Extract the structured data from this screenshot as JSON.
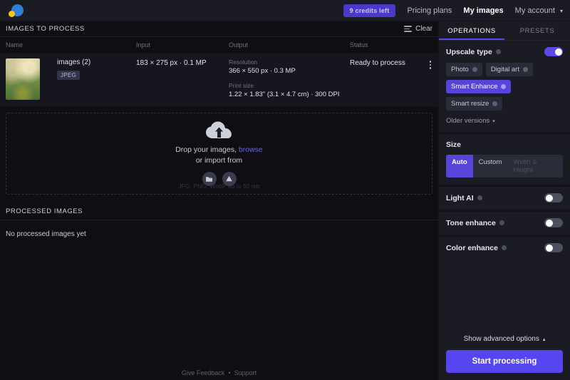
{
  "topbar": {
    "logo_name": "app-logo",
    "credits_badge": "9 credits left",
    "links": [
      {
        "label": "Pricing plans",
        "active": false
      },
      {
        "label": "My images",
        "active": true
      },
      {
        "label": "My account",
        "active": false
      }
    ]
  },
  "images_section": {
    "title": "IMAGES TO PROCESS",
    "clear_label": "Clear",
    "columns": {
      "name": "Name",
      "input": "Input",
      "output": "Output",
      "status": "Status"
    },
    "rows": [
      {
        "file_name": "images (2)",
        "format_tag": "JPEG",
        "input": "183 × 275 px · 0.1 MP",
        "output_resolution_label": "Resolution",
        "output_resolution_value": "366 × 550 px · 0.3 MP",
        "output_printsize_label": "Print size",
        "output_printsize_value": "1.22 × 1.83\" (3.1 × 4.7 cm) · 300 DPI",
        "status": "Ready to process"
      }
    ]
  },
  "dropzone": {
    "line1_prefix": "Drop your images, ",
    "browse": "browse",
    "line2": "or import from",
    "note": "JPG, PNG, WebP up to 50 mb",
    "import_sources": [
      "dropbox",
      "google-drive"
    ]
  },
  "processed_section": {
    "title": "PROCESSED IMAGES",
    "empty_text": "No processed images yet"
  },
  "footer": {
    "feedback": "Give Feedback",
    "separator": "•",
    "support": "Support"
  },
  "panel": {
    "tabs": [
      {
        "label": "OPERATIONS",
        "active": true
      },
      {
        "label": "PRESETS",
        "active": false
      }
    ],
    "upscale": {
      "title": "Upscale type",
      "enabled": true,
      "chips": [
        {
          "label": "Photo",
          "selected": false
        },
        {
          "label": "Digital art",
          "selected": false
        },
        {
          "label": "Smart Enhance",
          "selected": true
        },
        {
          "label": "Smart resize",
          "selected": false
        }
      ],
      "older_versions": "Older versions"
    },
    "size": {
      "title": "Size",
      "options": [
        {
          "label": "Auto",
          "selected": true,
          "disabled": false
        },
        {
          "label": "Custom",
          "selected": false,
          "disabled": false
        },
        {
          "label": "Width & Height",
          "selected": false,
          "disabled": true
        }
      ]
    },
    "toggles": [
      {
        "label": "Light AI",
        "enabled": false
      },
      {
        "label": "Tone enhance",
        "enabled": false
      },
      {
        "label": "Color enhance",
        "enabled": false
      }
    ],
    "advanced_label": "Show advanced options",
    "start_label": "Start processing"
  },
  "colors": {
    "accent": "#5645f0",
    "accent_muted": "#5645d8",
    "badge": "#4b3ac9",
    "panel_bg": "#1b1b24",
    "page_bg": "#0e0e13",
    "row_bg": "#16161e"
  }
}
